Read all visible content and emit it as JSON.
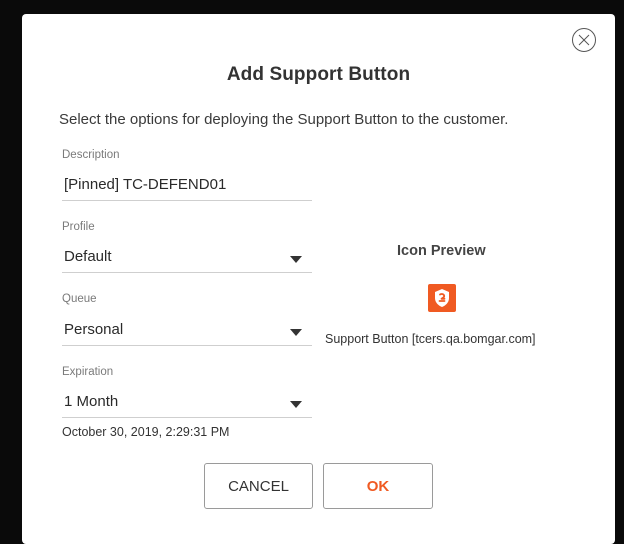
{
  "dialog": {
    "title": "Add Support Button",
    "subtitle": "Select the options for deploying the Support Button to the customer."
  },
  "fields": {
    "description": {
      "label": "Description",
      "value": "[Pinned] TC-DEFEND01"
    },
    "profile": {
      "label": "Profile",
      "value": "Default"
    },
    "queue": {
      "label": "Queue",
      "value": "Personal"
    },
    "expiration": {
      "label": "Expiration",
      "value": "1 Month",
      "date": "October 30, 2019, 2:29:31 PM"
    }
  },
  "preview": {
    "title": "Icon Preview",
    "icon": "support-button-shield-icon",
    "label": "Support Button [tcers.qa.bomgar.com]"
  },
  "buttons": {
    "cancel": "CANCEL",
    "ok": "OK"
  },
  "colors": {
    "accent": "#f05a22",
    "background": "#0a0a0a",
    "dialog": "#ffffff"
  }
}
